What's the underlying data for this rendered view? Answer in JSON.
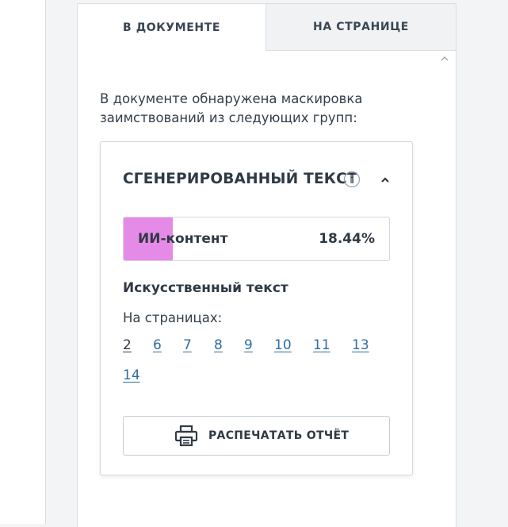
{
  "tabs": [
    {
      "label": "В ДОКУМЕНТЕ",
      "active": true
    },
    {
      "label": "НА СТРАНИЦЕ",
      "active": false
    }
  ],
  "intro": {
    "line1": "В документе обнаружена маскировка",
    "line2": "заимствований из следующих групп:"
  },
  "group": {
    "title": "СГЕНЕРИРОВАННЫЙ ТЕКСТ",
    "info_icon": "info-icon",
    "collapse_icon": "chevron-up-icon",
    "bar": {
      "label": "ИИ-контент",
      "value": "18.44%",
      "fill_fraction": 0.1844,
      "fill_color": "#e68ae8"
    },
    "subtitle": "Искусственный текст",
    "pages_label": "На страницах:",
    "pages": [
      "2",
      "6",
      "7",
      "8",
      "9",
      "10",
      "11",
      "13",
      "14"
    ],
    "current_page": "2",
    "print_label": "РАСПЕЧАТАТЬ ОТЧЁТ",
    "print_icon": "printer-icon"
  },
  "colors": {
    "link": "#2e6da4",
    "text": "#2f3a44",
    "border": "#d3d8de"
  }
}
